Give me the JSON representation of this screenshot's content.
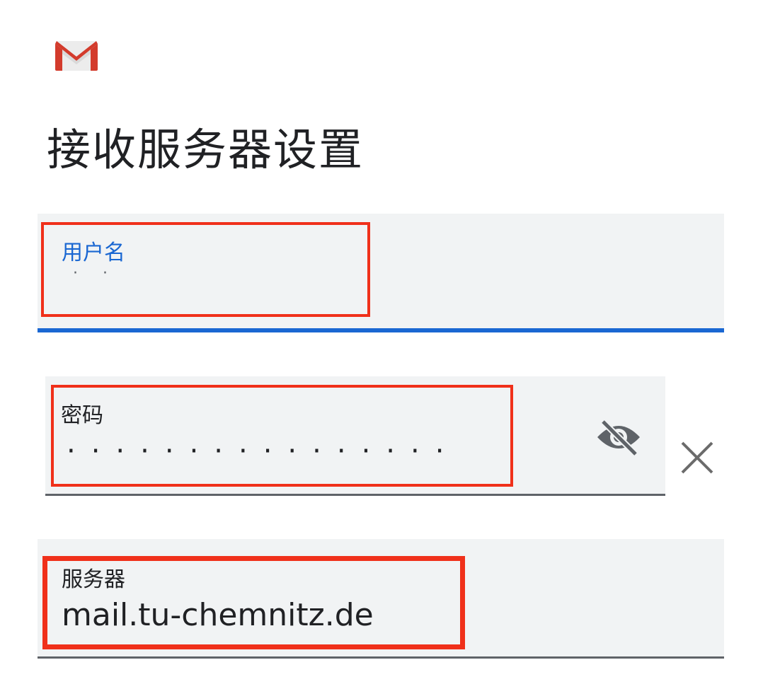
{
  "app": {
    "logo_icon": "gmail-logo"
  },
  "header": {
    "title": "接收服务器设置"
  },
  "fields": {
    "username": {
      "label": "用户名",
      "value": "· ·"
    },
    "password": {
      "label": "密码",
      "value": "················",
      "toggle_icon": "visibility-off-icon",
      "clear_icon": "close-icon"
    },
    "server": {
      "label": "服务器",
      "value": "mail.tu-chemnitz.de"
    }
  },
  "colors": {
    "accent": "#1a67d2",
    "field_background": "#f1f3f4",
    "highlight": "#f0301a",
    "text": "#202124",
    "icon": "#5f6368"
  }
}
